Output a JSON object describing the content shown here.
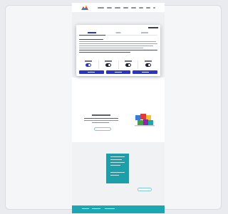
{
  "browser_card": {},
  "site_header": {
    "nav_items_count": 8
  },
  "consent_modal": {
    "tabs": [
      {
        "active": true
      },
      {
        "active": false
      },
      {
        "active": false
      }
    ],
    "toggles": [
      {
        "on": true
      },
      {
        "on": false
      },
      {
        "on": false
      },
      {
        "on": false
      }
    ],
    "buttons": [
      {},
      {},
      {}
    ]
  },
  "colors": {
    "accent": "#2a35c8",
    "teal": "#1aa7b1",
    "cta_outline": "#7ec7d6"
  }
}
